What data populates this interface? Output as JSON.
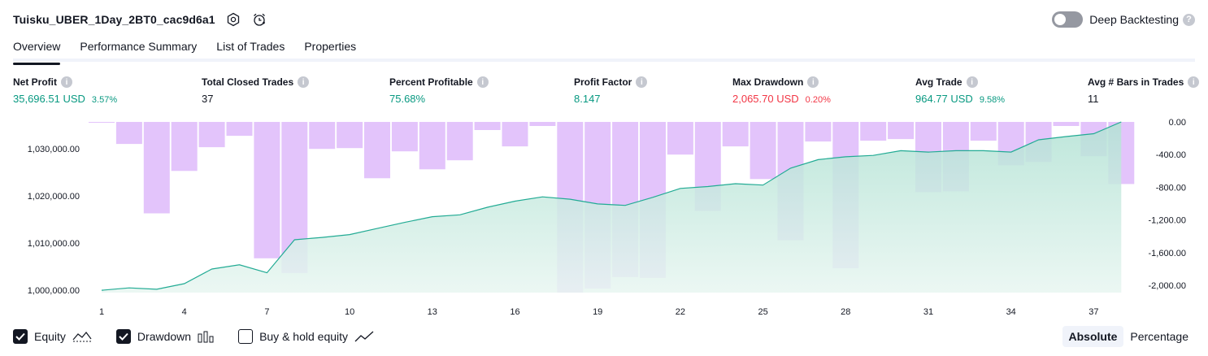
{
  "header": {
    "title": "Tuisku_UBER_1Day_2BT0_cac9d6a1",
    "settings_icon": "settings-hex-icon",
    "alert_icon": "alarm-clock-icon"
  },
  "deep_backtesting": {
    "label": "Deep Backtesting",
    "enabled": false,
    "help": "?"
  },
  "tabs": [
    {
      "label": "Overview",
      "active": true
    },
    {
      "label": "Performance Summary",
      "active": false
    },
    {
      "label": "List of Trades",
      "active": false
    },
    {
      "label": "Properties",
      "active": false
    }
  ],
  "metrics": {
    "net_profit": {
      "label": "Net Profit",
      "value": "35,696.51 USD",
      "pct": "3.57%"
    },
    "total_closed_trades": {
      "label": "Total Closed Trades",
      "value": "37"
    },
    "percent_profitable": {
      "label": "Percent Profitable",
      "value": "75.68%"
    },
    "profit_factor": {
      "label": "Profit Factor",
      "value": "8.147"
    },
    "max_drawdown": {
      "label": "Max Drawdown",
      "value": "2,065.70 USD",
      "pct": "0.20%"
    },
    "avg_trade": {
      "label": "Avg Trade",
      "value": "964.77 USD",
      "pct": "9.58%"
    },
    "avg_bars": {
      "label": "Avg # Bars in Trades",
      "value": "11"
    },
    "info_glyph": "i"
  },
  "colors": {
    "equity_line": "#22ab94",
    "equity_fill_top": "#b2e2d4",
    "equity_fill_bottom": "#e8f6f1",
    "drawdown_bar": "#b565f5",
    "positive": "#089981",
    "negative": "#f23645"
  },
  "chart_data": {
    "type": "line",
    "x": [
      1,
      2,
      3,
      4,
      5,
      6,
      7,
      8,
      9,
      10,
      11,
      12,
      13,
      14,
      15,
      16,
      17,
      18,
      19,
      20,
      21,
      22,
      23,
      24,
      25,
      26,
      27,
      28,
      29,
      30,
      31,
      32,
      33,
      34,
      35,
      36,
      37,
      38
    ],
    "x_ticks": [
      "1",
      "4",
      "7",
      "10",
      "13",
      "16",
      "19",
      "22",
      "25",
      "28",
      "31",
      "34",
      "37"
    ],
    "y_left_ticks": [
      "1,000,000.00",
      "1,010,000.00",
      "1,020,000.00",
      "1,030,000.00"
    ],
    "y_left_range": [
      999500,
      1035700
    ],
    "y_right_ticks": [
      "0.00",
      "-400.00",
      "-800.00",
      "-1,200.00",
      "-1,600.00",
      "-2,000.00"
    ],
    "y_right_range": [
      -2090,
      0
    ],
    "series": [
      {
        "name": "Equity",
        "kind": "area-line",
        "axis": "left",
        "values": [
          1000000,
          1000500,
          1000200,
          1001400,
          1004500,
          1005400,
          1003700,
          1010700,
          1011200,
          1011800,
          1013100,
          1014400,
          1015600,
          1016000,
          1017600,
          1018900,
          1019800,
          1019300,
          1018300,
          1018000,
          1019700,
          1021600,
          1022000,
          1022600,
          1022300,
          1025900,
          1027700,
          1028300,
          1028600,
          1029600,
          1029300,
          1029600,
          1029600,
          1029300,
          1031900,
          1032600,
          1033200,
          1035700
        ]
      },
      {
        "name": "Drawdown",
        "kind": "bar",
        "axis": "right",
        "values": [
          -10,
          -270,
          -1120,
          -600,
          -310,
          -170,
          -1670,
          -1850,
          -330,
          -320,
          -690,
          -360,
          -580,
          -470,
          -100,
          -300,
          -50,
          -2090,
          -2040,
          -1900,
          -1910,
          -400,
          -1090,
          -300,
          -700,
          -1450,
          -240,
          -1790,
          -230,
          -210,
          -860,
          -850,
          -230,
          -530,
          -490,
          -50,
          -420,
          -760
        ]
      }
    ],
    "grid": false
  },
  "legend": {
    "equity": {
      "label": "Equity",
      "checked": true,
      "icon": "equity-line-icon"
    },
    "drawdown": {
      "label": "Drawdown",
      "checked": true,
      "icon": "bars-icon"
    },
    "buy_hold": {
      "label": "Buy & hold equity",
      "checked": false,
      "icon": "trend-line-icon"
    }
  },
  "mode": {
    "absolute": "Absolute",
    "percentage": "Percentage",
    "selected": "Absolute"
  }
}
